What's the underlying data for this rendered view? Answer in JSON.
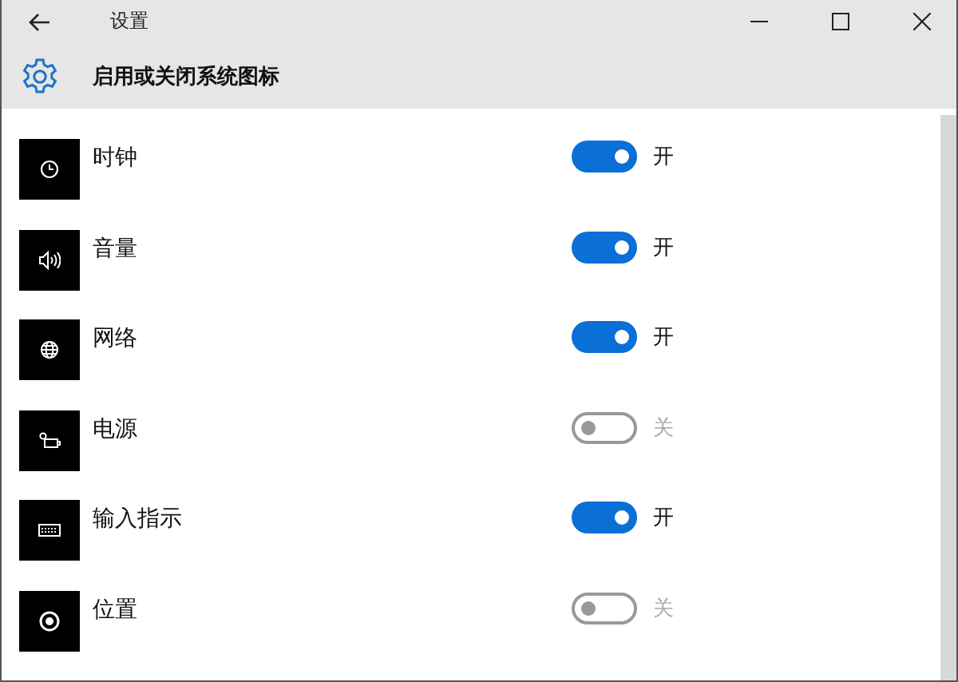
{
  "window": {
    "title": "设置"
  },
  "header": {
    "title": "启用或关闭系统图标"
  },
  "items": [
    {
      "kind": "clock",
      "label": "时钟",
      "on": true,
      "state_text": "开"
    },
    {
      "kind": "volume",
      "label": "音量",
      "on": true,
      "state_text": "开"
    },
    {
      "kind": "network",
      "label": "网络",
      "on": true,
      "state_text": "开"
    },
    {
      "kind": "power",
      "label": "电源",
      "on": false,
      "state_text": "关"
    },
    {
      "kind": "keyboard",
      "label": "输入指示",
      "on": true,
      "state_text": "开"
    },
    {
      "kind": "location",
      "label": "位置",
      "on": false,
      "state_text": "关"
    }
  ]
}
